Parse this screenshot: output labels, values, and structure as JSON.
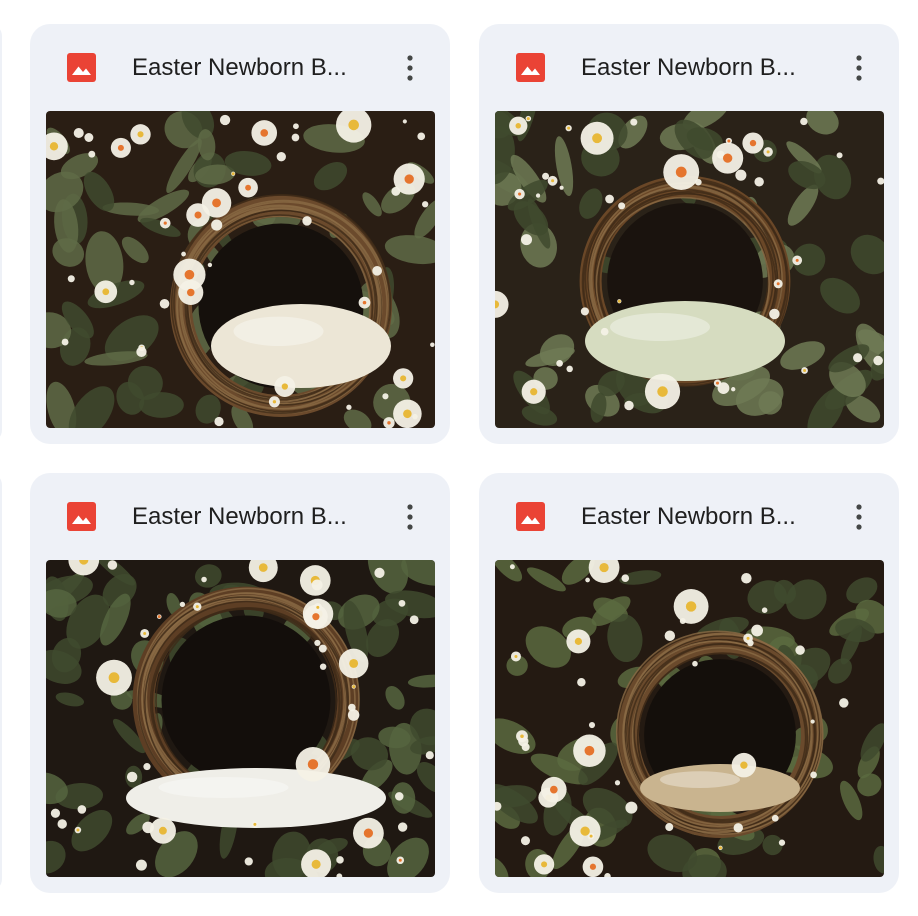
{
  "files": [
    {
      "name": "Easter Newborn B...",
      "icon": "image-file-icon",
      "menu_icon": "more-vert-icon",
      "thumbnail": {
        "variant": "nest-with-white-pillow",
        "background": "#2a1e14",
        "foliage": "#5f6b47",
        "nest": "#6b4a2c",
        "blanket": "#ece6d6",
        "hole": "#15100c"
      }
    },
    {
      "name": "Easter Newborn B...",
      "icon": "image-file-icon",
      "menu_icon": "more-vert-icon",
      "thumbnail": {
        "variant": "nest-with-green-tulle",
        "background": "#2a2218",
        "foliage": "#6e7a55",
        "nest": "#6a4727",
        "blanket": "#d6dcc0",
        "hole": "#1a130e"
      }
    },
    {
      "name": "Easter Newborn B...",
      "icon": "image-file-icon",
      "menu_icon": "more-vert-icon",
      "thumbnail": {
        "variant": "wreath-with-fluffy-blanket",
        "background": "#1f1812",
        "foliage": "#56653f",
        "nest": "#5d3e24",
        "blanket": "#efeee8",
        "hole": "#130e0b"
      }
    },
    {
      "name": "Easter Newborn B...",
      "icon": "image-file-icon",
      "menu_icon": "more-vert-icon",
      "thumbnail": {
        "variant": "wreath-with-beige-cushion",
        "background": "#241a12",
        "foliage": "#5a6a40",
        "nest": "#6a4a2c",
        "blanket": "#c9b48f",
        "hole": "#140f0b"
      }
    }
  ],
  "colors": {
    "card_background": "#eef1f7",
    "title_text": "#1f1f1f",
    "image_icon_red": "#ea4335",
    "menu_icon": "#444746",
    "flower_white": "#f4f1e6",
    "flower_yellow": "#e8b93a",
    "flower_orange": "#e5752e"
  }
}
